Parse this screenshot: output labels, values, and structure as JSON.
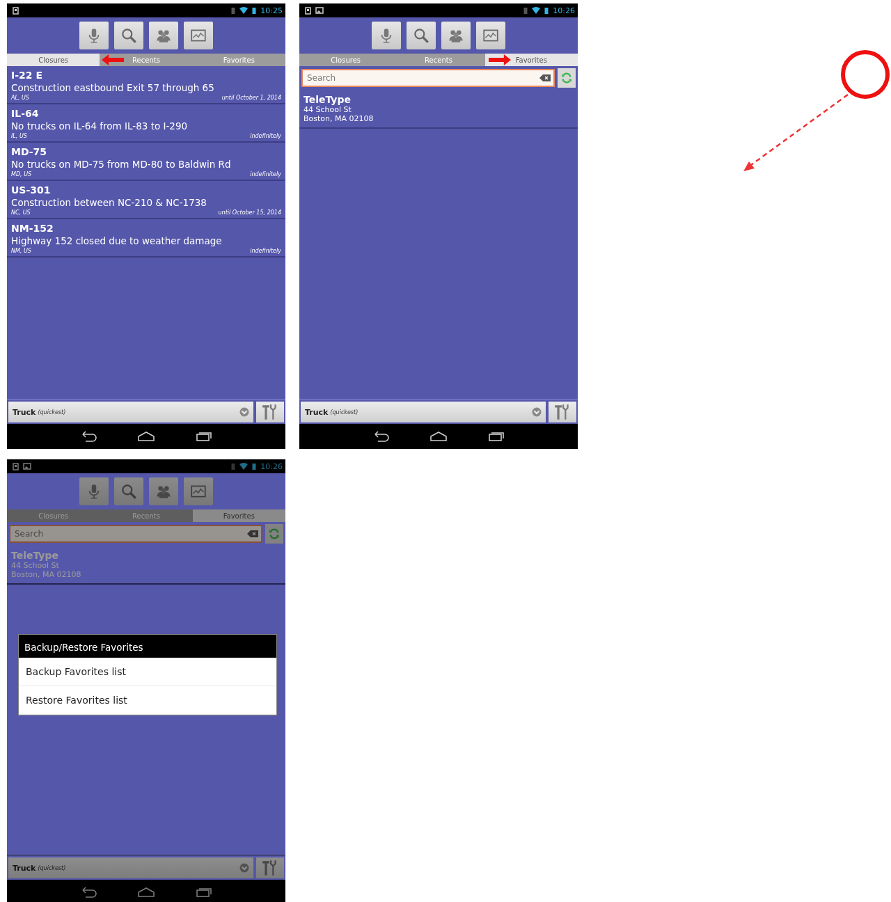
{
  "screens": [
    {
      "status_bar": {
        "icons": [
          {
            "kind": "device"
          }
        ],
        "time": "10:25"
      },
      "tabs": [
        {
          "label": "Closures",
          "selected": true
        },
        {
          "label": "Recents",
          "selected": false
        },
        {
          "label": "Favorites",
          "selected": false
        }
      ],
      "pointer": {
        "kind": "left"
      },
      "dimmed": false,
      "closures": [
        {
          "road": "I-22 E",
          "description": "Construction eastbound Exit 57 through 65",
          "region": "AL, US",
          "duration": "until October 1, 2014"
        },
        {
          "road": "IL-64",
          "description": "No trucks on IL-64 from IL-83 to I-290",
          "region": "IL, US",
          "duration": "indefinitely"
        },
        {
          "road": "MD-75",
          "description": "No trucks on MD-75 from MD-80 to Baldwin Rd",
          "region": "MD, US",
          "duration": "indefinitely"
        },
        {
          "road": "US-301",
          "description": "Construction between NC-210 & NC-1738",
          "region": "NC, US",
          "duration": "until October 15, 2014"
        },
        {
          "road": "NM-152",
          "description": "Highway 152 closed due to weather damage",
          "region": "NM, US",
          "duration": "indefinitely"
        }
      ],
      "bottom_bar": {
        "vehicle": "Truck",
        "route": "(quickest)"
      }
    },
    {
      "status_bar": {
        "icons": [
          {
            "kind": "device"
          },
          {
            "kind": "image"
          }
        ],
        "time": "10:26"
      },
      "tabs": [
        {
          "label": "Closures",
          "selected": false
        },
        {
          "label": "Recents",
          "selected": false
        },
        {
          "label": "Favorites",
          "selected": true
        }
      ],
      "pointer": {
        "kind": "right"
      },
      "dimmed": false,
      "search": {
        "placeholder": "Search"
      },
      "favorites": [
        {
          "name": "TeleType",
          "street": "44 School St",
          "city": "Boston, MA 02108"
        }
      ],
      "bottom_bar": {
        "vehicle": "Truck",
        "route": "(quickest)"
      }
    },
    {
      "status_bar": {
        "icons": [
          {
            "kind": "device"
          },
          {
            "kind": "image"
          }
        ],
        "time": "10:26"
      },
      "tabs": [
        {
          "label": "Closures",
          "selected": false
        },
        {
          "label": "Recents",
          "selected": false
        },
        {
          "label": "Favorites",
          "selected": true
        }
      ],
      "dimmed": true,
      "search": {
        "placeholder": "Search"
      },
      "favorites": [
        {
          "name": "TeleType",
          "street": "44 School St",
          "city": "Boston, MA 02108"
        }
      ],
      "bottom_bar": {
        "vehicle": "Truck",
        "route": "(quickest)"
      },
      "dialog": {
        "title": "Backup/Restore Favorites",
        "options": [
          "Backup Favorites list",
          "Restore Favorites list"
        ]
      }
    }
  ]
}
